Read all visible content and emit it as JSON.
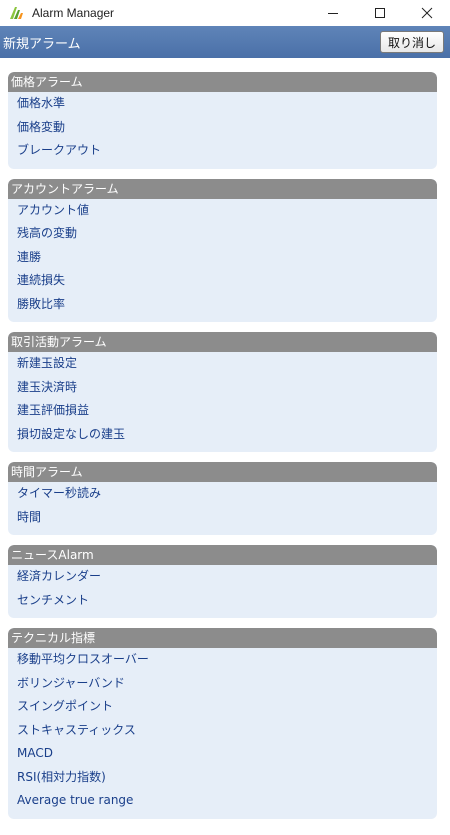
{
  "window": {
    "title": "Alarm Manager"
  },
  "header": {
    "title": "新規アラーム",
    "cancel_label": "取り消し"
  },
  "sections": [
    {
      "title": "価格アラーム",
      "items": [
        "価格水準",
        "価格変動",
        "ブレークアウト"
      ]
    },
    {
      "title": "アカウントアラーム",
      "items": [
        "アカウント値",
        "残高の変動",
        "連勝",
        "連続損失",
        "勝敗比率"
      ]
    },
    {
      "title": "取引活動アラーム",
      "items": [
        "新建玉設定",
        "建玉決済時",
        "建玉評価損益",
        "損切設定なしの建玉"
      ]
    },
    {
      "title": "時間アラーム",
      "items": [
        "タイマー秒読み",
        "時間"
      ]
    },
    {
      "title": "ニュースAlarm",
      "items": [
        "経済カレンダー",
        "センチメント"
      ]
    },
    {
      "title": "テクニカル指標",
      "items": [
        "移動平均クロスオーバー",
        "ボリンジャーバンド",
        "スイングポイント",
        "ストキャスティックス",
        "MACD",
        "RSI(相対力指数)",
        "Average true range"
      ]
    }
  ],
  "colors": {
    "header_bg": "#4a70a8",
    "section_header_bg": "#8c8c8c",
    "section_bg": "#e6eef8",
    "item_text": "#1a3f8a"
  }
}
